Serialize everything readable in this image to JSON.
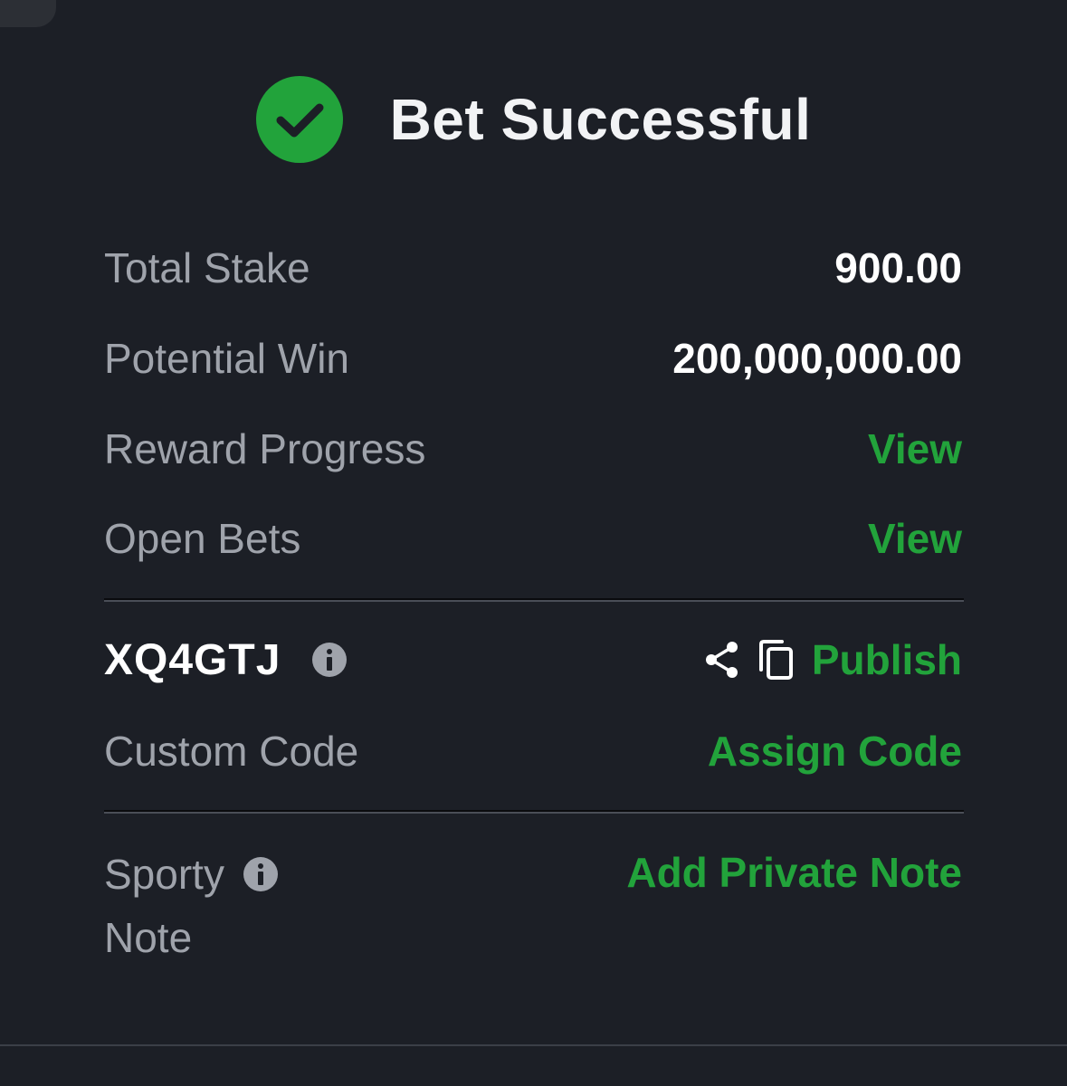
{
  "header": {
    "title": "Bet Successful",
    "check_icon": "check-circle-icon",
    "accent": "#22a33b"
  },
  "summary": {
    "total_stake_label": "Total Stake",
    "total_stake_value": "900.00",
    "potential_win_label": "Potential Win",
    "potential_win_value": "200,000,000.00",
    "reward_progress_label": "Reward Progress",
    "reward_progress_link": "View",
    "open_bets_label": "Open Bets",
    "open_bets_link": "View"
  },
  "booking": {
    "code": "XQ4GTJ",
    "info_icon": "info-icon",
    "share_icon": "share-icon",
    "copy_icon": "copy-icon",
    "publish_label": "Publish",
    "custom_code_label": "Custom Code",
    "assign_code_label": "Assign Code"
  },
  "note": {
    "label_line1": "Sporty",
    "label_line2": "Note",
    "info_icon": "info-icon",
    "add_note_label": "Add Private Note"
  },
  "colors": {
    "background": "#1c1f26",
    "link_green": "#22a33b",
    "label_gray": "#9fa3ab",
    "value_white": "#ffffff"
  }
}
